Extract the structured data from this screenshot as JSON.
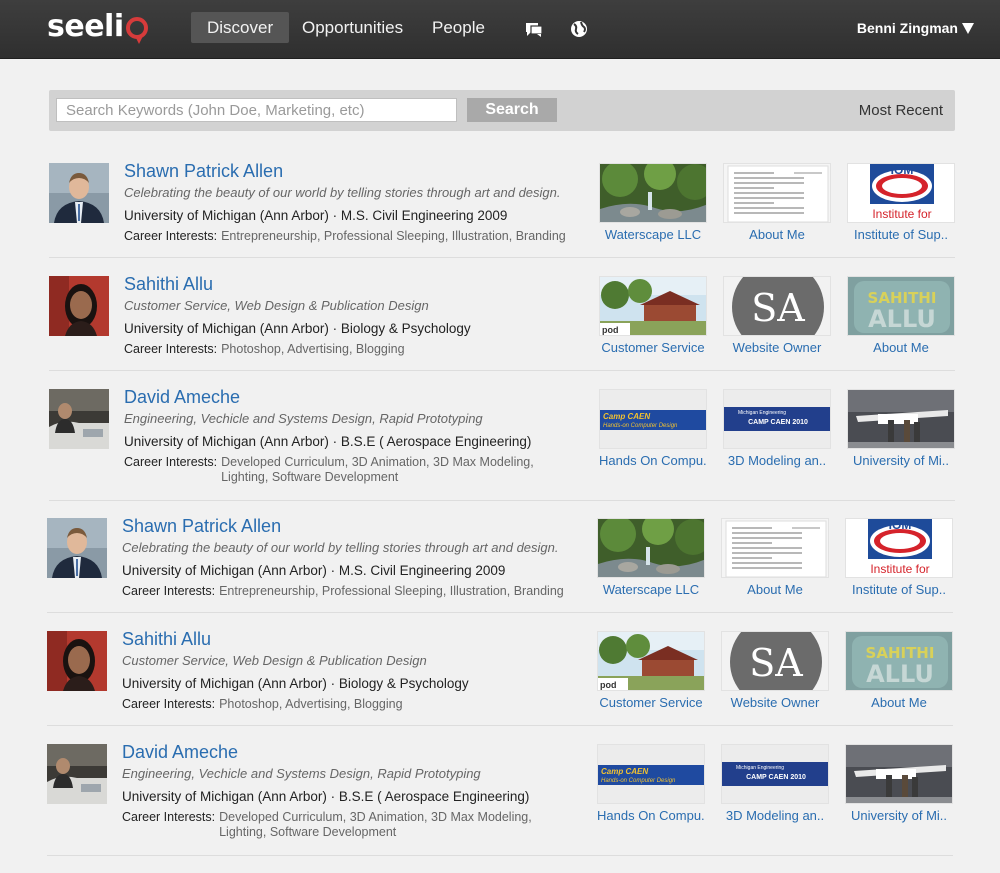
{
  "brand": {
    "logo_text": "seeli"
  },
  "nav": {
    "items": [
      {
        "label": "Discover",
        "active": true
      },
      {
        "label": "Opportunities",
        "active": false
      },
      {
        "label": "People",
        "active": false
      }
    ],
    "icons": [
      "chat-icon",
      "globe-icon"
    ],
    "user": "Benni Zingman"
  },
  "search": {
    "placeholder": "Search Keywords (John Doe, Marketing, etc)",
    "value": "",
    "button_label": "Search",
    "sort_label": "Most Recent"
  },
  "people": [
    {
      "name": "Shawn Patrick Allen",
      "tagline": "Celebrating the beauty of our world by telling stories through art and design.",
      "school": "University of Michigan (Ann Arbor) · M.S. Civil Engineering 2009",
      "interests_label": "Career Interests:",
      "interests": "Entrepreneurship, Professional Sleeping, Illustration, Branding",
      "avatar": "man-suit",
      "projects": [
        {
          "title": "Waterscape LLC",
          "thumb": "waterscape"
        },
        {
          "title": "About Me",
          "thumb": "document"
        },
        {
          "title": "Institute of Sup..",
          "thumb": "iom"
        }
      ]
    },
    {
      "name": "Sahithi Allu",
      "tagline": "Customer Service, Web Design & Publication Design",
      "school": "University of Michigan (Ann Arbor) · Biology & Psychology",
      "interests_label": "Career Interests:",
      "interests": "Photoshop, Advertising, Blogging",
      "avatar": "woman",
      "projects": [
        {
          "title": "Customer Service",
          "thumb": "building"
        },
        {
          "title": "Website Owner",
          "thumb": "sa-logo"
        },
        {
          "title": "About Me",
          "thumb": "sahithi"
        }
      ]
    },
    {
      "name": "David Ameche",
      "tagline": "Engineering, Vechicle and Systems Design, Rapid Prototyping",
      "school": "University of Michigan (Ann Arbor) · B.S.E ( Aerospace Engineering)",
      "interests_label": "Career Interests:",
      "interests": "Developed Curriculum, 3D Animation, 3D Max Modeling, Lighting, Software Development",
      "avatar": "man-car",
      "projects": [
        {
          "title": "Hands On Compu..",
          "thumb": "camp-caen"
        },
        {
          "title": "3D Modeling an..",
          "thumb": "camp-caen-2010"
        },
        {
          "title": "University of Mi..",
          "thumb": "plane"
        }
      ]
    },
    {
      "name": "Shawn Patrick Allen",
      "tagline": "Celebrating the beauty of our world by telling stories through art and design.",
      "school": "University of Michigan (Ann Arbor) · M.S. Civil Engineering 2009",
      "interests_label": "Career Interests:",
      "interests": "Entrepreneurship, Professional Sleeping, Illustration, Branding",
      "avatar": "man-suit",
      "projects": [
        {
          "title": "Waterscape LLC",
          "thumb": "waterscape"
        },
        {
          "title": "About Me",
          "thumb": "document"
        },
        {
          "title": "Institute of Sup..",
          "thumb": "iom"
        }
      ]
    },
    {
      "name": "Sahithi Allu",
      "tagline": "Customer Service, Web Design & Publication Design",
      "school": "University of Michigan (Ann Arbor) · Biology & Psychology",
      "interests_label": "Career Interests:",
      "interests": "Photoshop, Advertising, Blogging",
      "avatar": "woman",
      "projects": [
        {
          "title": "Customer Service",
          "thumb": "building"
        },
        {
          "title": "Website Owner",
          "thumb": "sa-logo"
        },
        {
          "title": "About Me",
          "thumb": "sahithi"
        }
      ]
    },
    {
      "name": "David Ameche",
      "tagline": "Engineering, Vechicle and Systems Design, Rapid Prototyping",
      "school": "University of Michigan (Ann Arbor) · B.S.E ( Aerospace Engineering)",
      "interests_label": "Career Interests:",
      "interests": "Developed Curriculum, 3D Animation, 3D Max Modeling, Lighting, Software Development",
      "avatar": "man-car",
      "projects": [
        {
          "title": "Hands On Compu..",
          "thumb": "camp-caen"
        },
        {
          "title": "3D Modeling an..",
          "thumb": "camp-caen-2010"
        },
        {
          "title": "University of Mi..",
          "thumb": "plane"
        }
      ]
    }
  ],
  "thumb_text": {
    "iom": "IOM",
    "iom_sub": "Institute for",
    "sa": "SA",
    "sahithi_top": "SAHITHI",
    "sahithi_bottom": "ALLU",
    "camp_caen_1": "Camp CAEN",
    "camp_caen_2": "Hands-on Computer Design",
    "michigan": "Michigan Engineering",
    "camp_caen_2010": "CAMP CAEN 2010",
    "pod": "pod"
  },
  "colors": {
    "link": "#2a6db0",
    "nav_bg": "#353535",
    "logo_accent": "#d63b3b"
  }
}
